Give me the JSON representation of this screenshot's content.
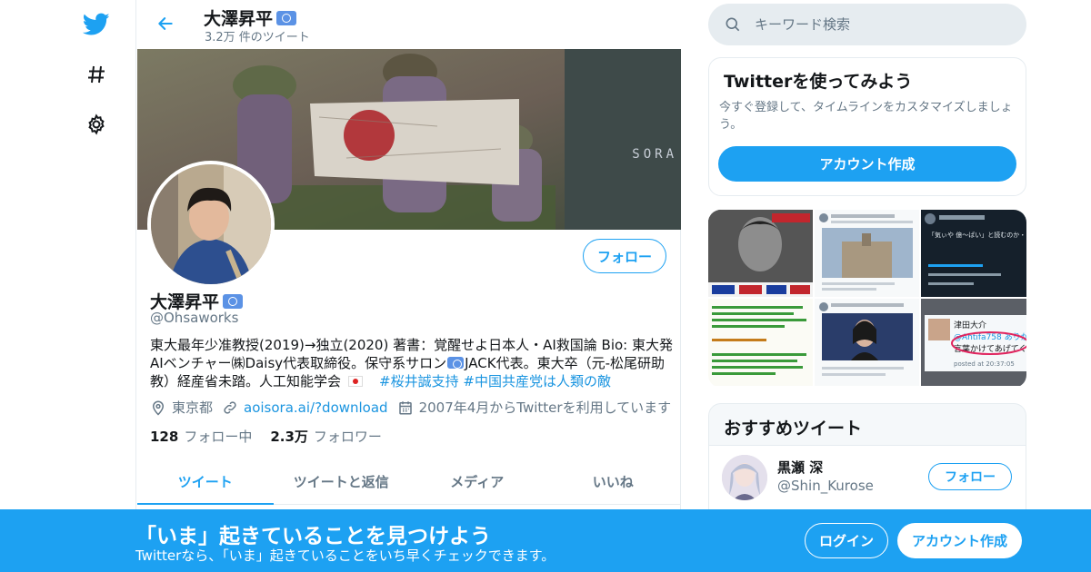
{
  "nav": {
    "icons": [
      "twitter-bird-icon",
      "hashtag-icon",
      "gear-icon"
    ]
  },
  "topbar": {
    "name": "大澤昇平",
    "tweet_count": "3.2万 件のツイート"
  },
  "banner": {
    "watermark": "SORA"
  },
  "profile": {
    "follow_label": "フォロー",
    "name": "大澤昇平",
    "handle": "@Ohsaworks",
    "bio_line1": "東大最年少准教授(2019)→独立(2020) 著書：覚醒せよ日本人・AI救国論 Bio: 東大発",
    "bio_line2_a": "AIベンチャー㈱Daisy代表取締役。保守系サロン",
    "bio_line2_b": "JACK代表。東大卒（元-松尾研助",
    "bio_line3": "教）経産省未踏。人工知能学会",
    "hashtag1": "#桜井誠支持",
    "hashtag2": "#中国共産党は人類の敵",
    "location": "東京都",
    "website": "aoisora.ai/?download",
    "joined": "2007年4月からTwitterを利用しています",
    "following_count": "128",
    "following_label": "フォロー中",
    "followers_count": "2.3万",
    "followers_label": "フォロワー"
  },
  "tabs": [
    {
      "label": "ツイート",
      "active": true
    },
    {
      "label": "ツイートと返信",
      "active": false
    },
    {
      "label": "メディア",
      "active": false
    },
    {
      "label": "いいね",
      "active": false
    }
  ],
  "search": {
    "placeholder": "キーワード検索"
  },
  "signup_card": {
    "title": "Twitterを使ってみよう",
    "description": "今すぐ登録して、タイムラインをカスタマイズしましょう。",
    "button": "アカウント作成"
  },
  "media": {
    "cell3_text": "「気ぃや 億〜ばい」と読むのか・・・勉強になった",
    "cell6_handle": "津田大介",
    "cell6_mention": "@Antifa758 ありが",
    "cell6_text": "言葉かけてあげてく",
    "cell6_time": "posted at 20:37:05"
  },
  "recommended": {
    "title": "おすすめツイート",
    "name": "黒瀬 深",
    "handle": "@Shin_Kurose",
    "follow_label": "フォロー"
  },
  "bottom_bar": {
    "title": "「いま」起きていることを見つけよう",
    "subtitle": "Twitterなら、「いま」起きていることをいち早くチェックできます。",
    "login": "ログイン",
    "signup": "アカウント作成"
  },
  "colors": {
    "accent": "#1da1f2",
    "link": "#1b95e0",
    "muted": "#657786"
  }
}
